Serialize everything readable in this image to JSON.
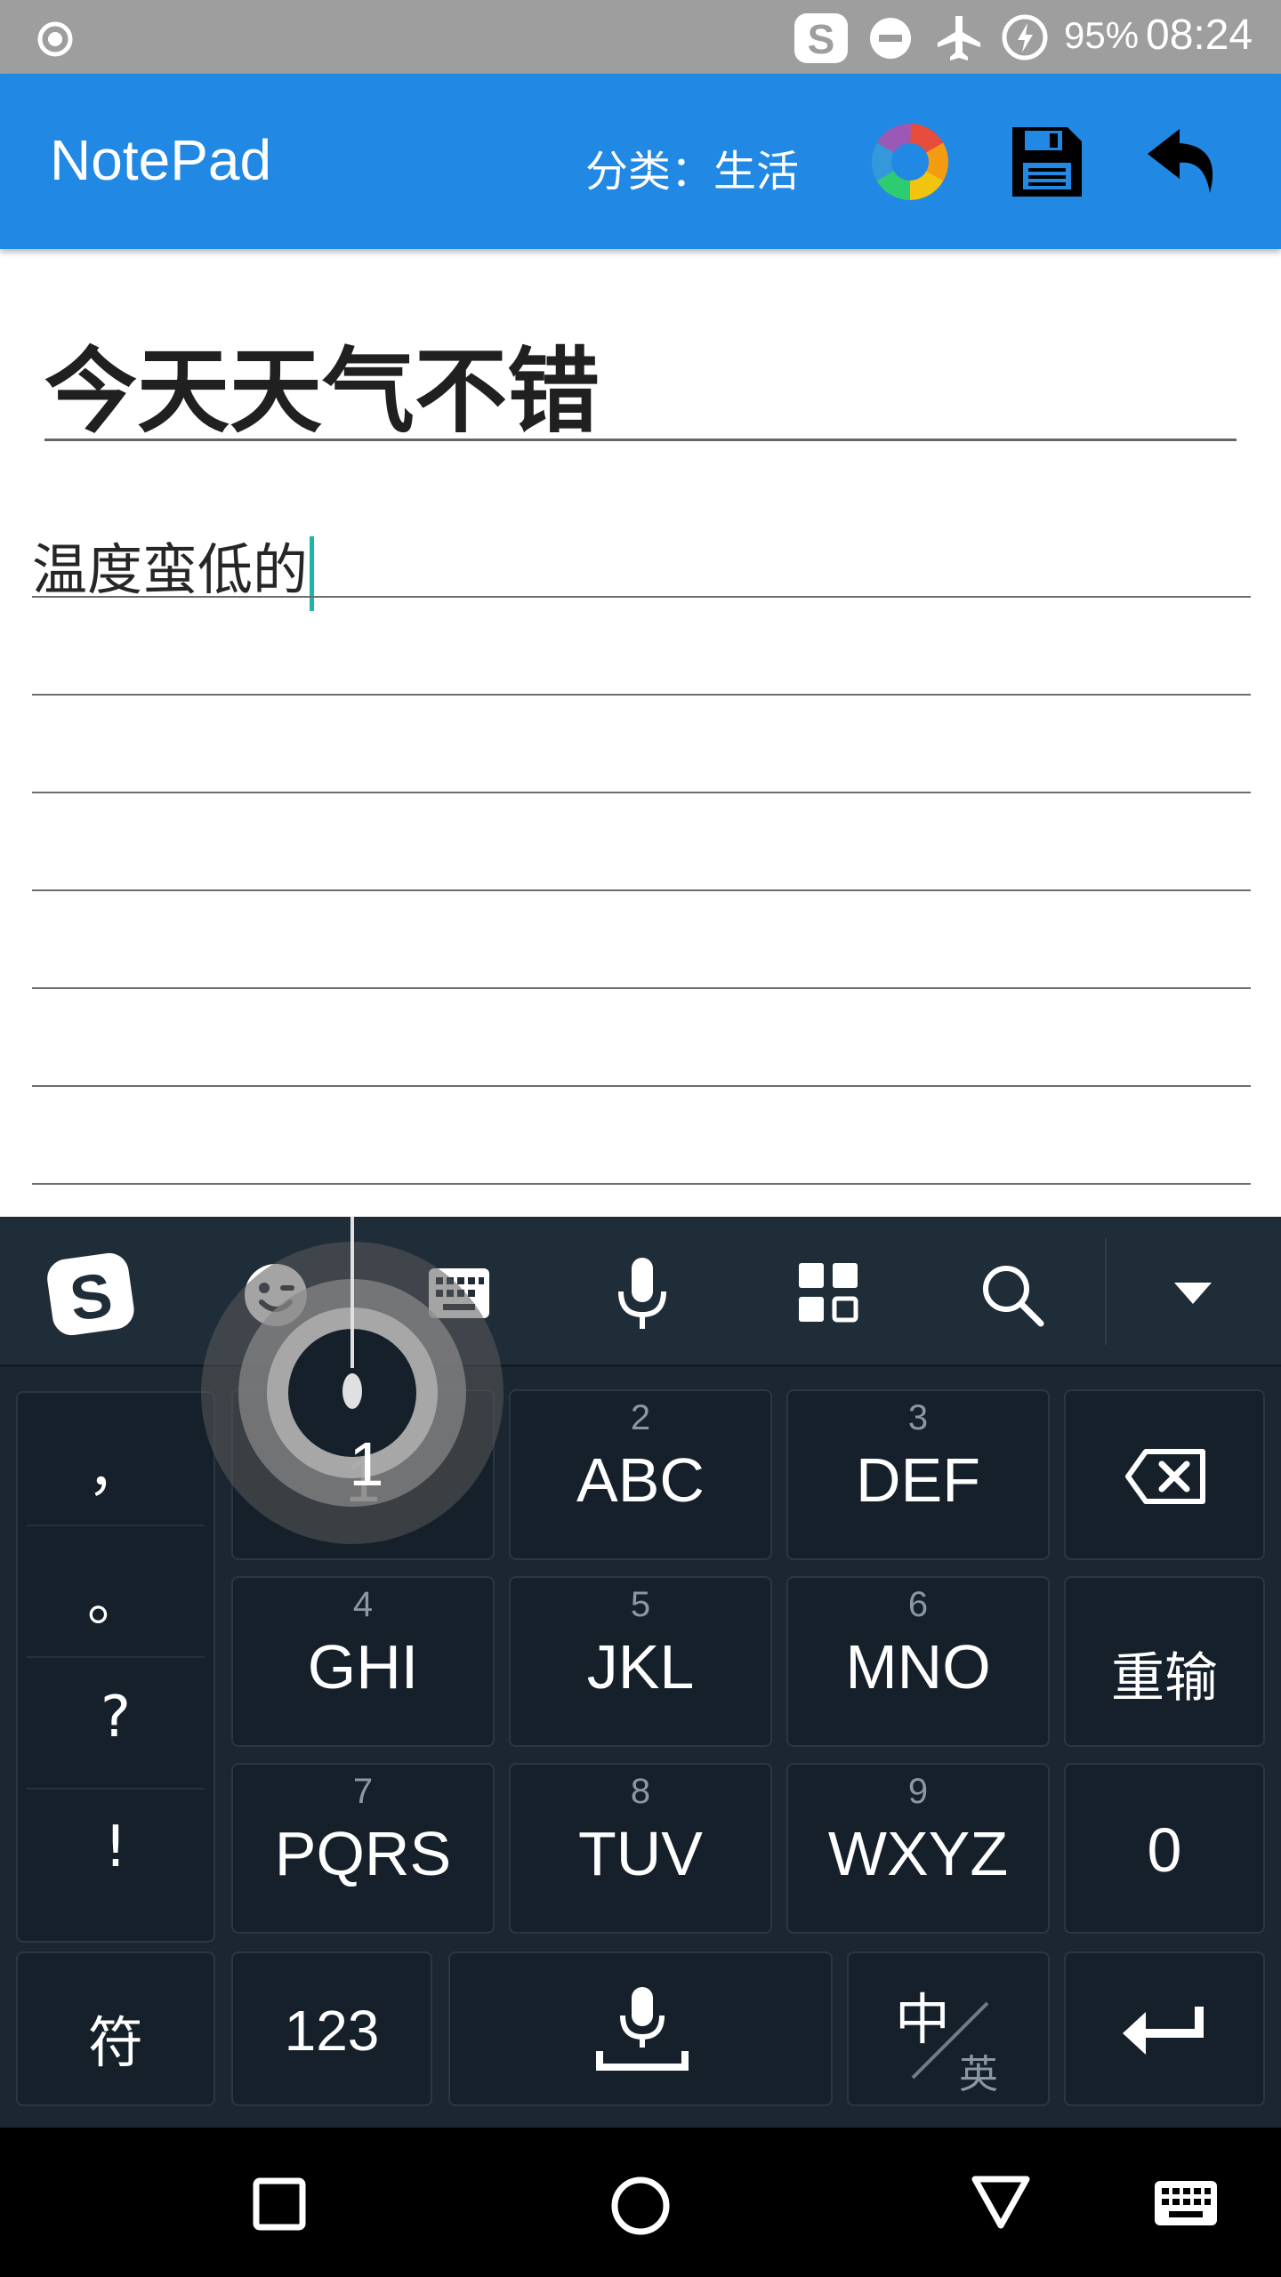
{
  "status_bar": {
    "battery": "95%",
    "time": "08:24"
  },
  "app_bar": {
    "title": "NotePad",
    "category": "分类：生活"
  },
  "note": {
    "title": "今天天气不错",
    "body": "温度蛮低的"
  },
  "keyboard": {
    "punctuation": [
      "，",
      "。",
      "?",
      "!"
    ],
    "keys": [
      {
        "sub": "",
        "main": "1"
      },
      {
        "sub": "2",
        "main": "ABC"
      },
      {
        "sub": "3",
        "main": "DEF"
      },
      {
        "sub": "4",
        "main": "GHI"
      },
      {
        "sub": "5",
        "main": "JKL"
      },
      {
        "sub": "6",
        "main": "MNO"
      },
      {
        "sub": "7",
        "main": "PQRS"
      },
      {
        "sub": "8",
        "main": "TUV"
      },
      {
        "sub": "9",
        "main": "WXYZ"
      }
    ],
    "reinput_label": "重输",
    "zero_label": "0",
    "symbol_label": "符",
    "numbers_label": "123",
    "lang_cn": "中",
    "lang_en": "英"
  },
  "colors": {
    "app_bar": "#2188e3",
    "status_bar": "#9e9e9e",
    "keyboard_bg": "#1b2631",
    "caret": "#1cb6a8"
  },
  "icons": [
    "record-icon",
    "sogou-icon",
    "dnd-icon",
    "airplane-icon",
    "battery-charging-icon",
    "color-wheel-icon",
    "save-icon",
    "undo-icon",
    "emoji-icon",
    "keyboard-icon",
    "mic-icon",
    "apps-icon",
    "search-icon",
    "collapse-icon",
    "backspace-icon",
    "enter-icon",
    "space-mic-icon",
    "recent-apps-icon",
    "home-icon",
    "back-icon",
    "keyboard-switch-icon"
  ]
}
